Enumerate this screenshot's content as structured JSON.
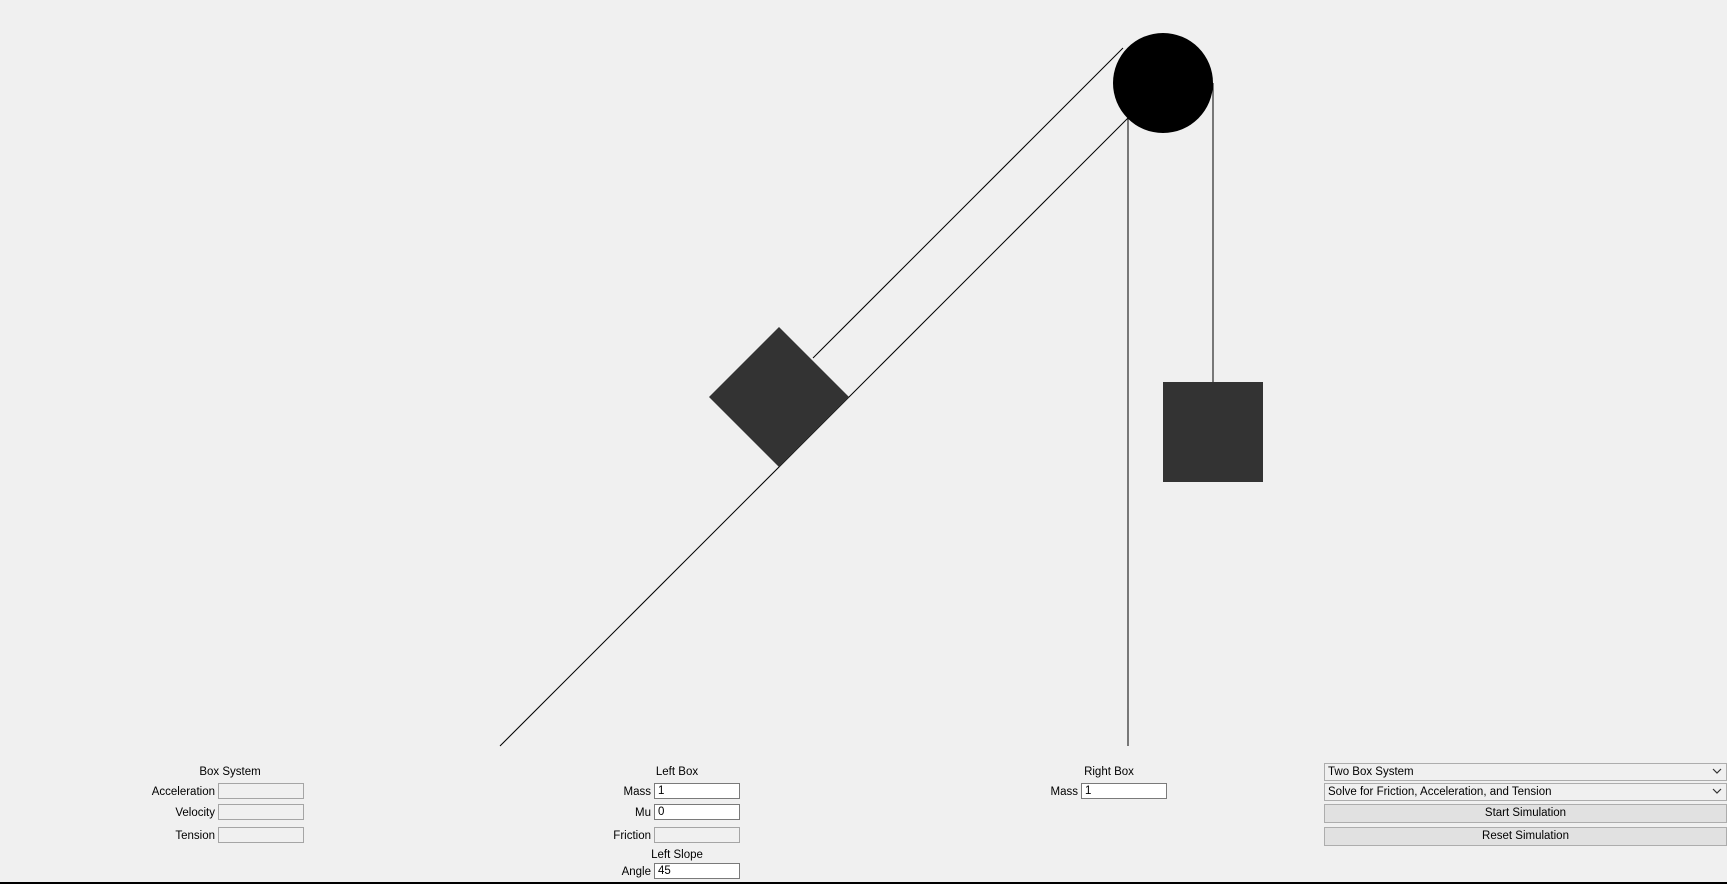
{
  "box_system": {
    "title": "Box System",
    "acceleration_label": "Acceleration",
    "acceleration_value": "",
    "velocity_label": "Velocity",
    "velocity_value": "",
    "tension_label": "Tension",
    "tension_value": ""
  },
  "left_box": {
    "title": "Left Box",
    "mass_label": "Mass",
    "mass_value": "1",
    "mu_label": "Mu",
    "mu_value": "0",
    "friction_label": "Friction",
    "friction_value": ""
  },
  "left_slope": {
    "title": "Left Slope",
    "angle_label": "Angle",
    "angle_value": "45"
  },
  "right_box": {
    "title": "Right Box",
    "mass_label": "Mass",
    "mass_value": "1"
  },
  "controls": {
    "system_select": "Two Box System",
    "solve_select": "Solve for Friction, Acceleration, and Tension",
    "start_button": "Start Simulation",
    "reset_button": "Reset Simulation"
  },
  "colors": {
    "background": "#f0f0f0",
    "box": "#333333",
    "pulley": "#000000",
    "line": "#000000"
  }
}
